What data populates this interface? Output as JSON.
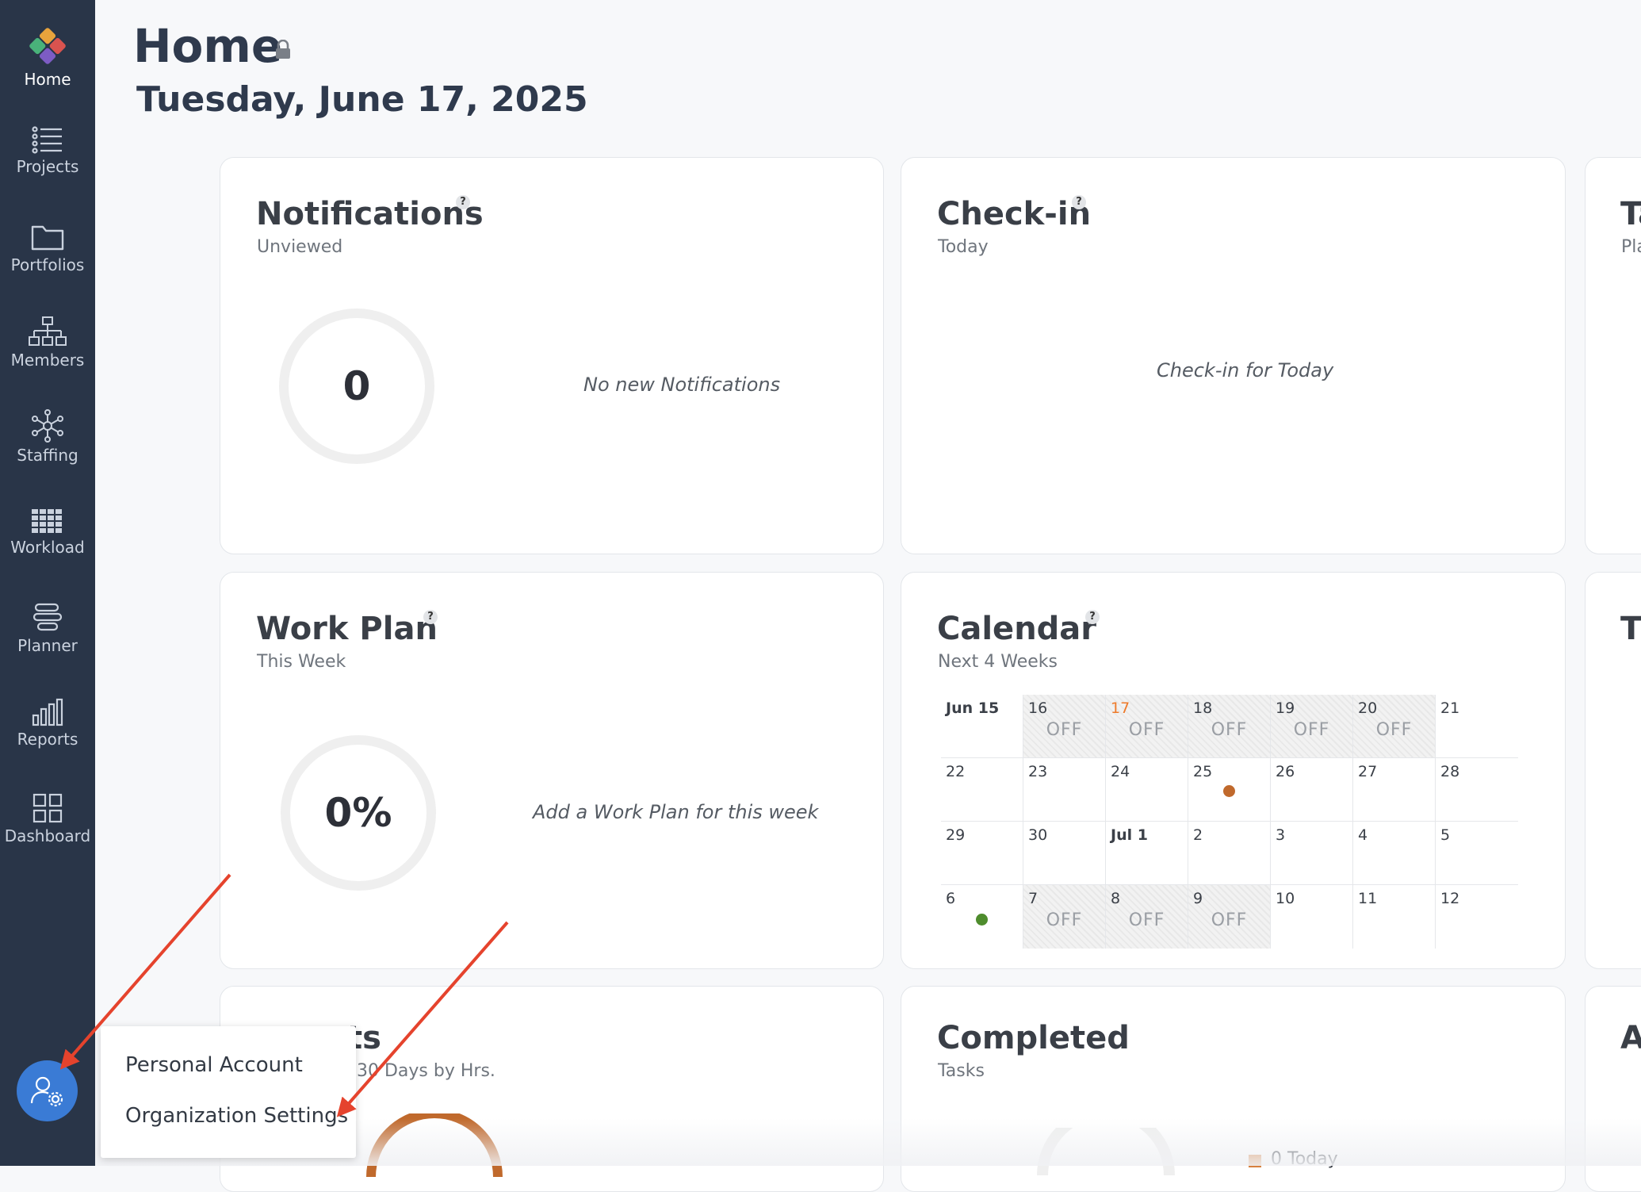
{
  "sidebar": {
    "items": [
      {
        "label": "Home",
        "icon": "logo-icon"
      },
      {
        "label": "Projects",
        "icon": "list-icon"
      },
      {
        "label": "Portfolios",
        "icon": "folder-icon"
      },
      {
        "label": "Members",
        "icon": "org-chart-icon"
      },
      {
        "label": "Staffing",
        "icon": "network-icon"
      },
      {
        "label": "Workload",
        "icon": "grid-icon"
      },
      {
        "label": "Planner",
        "icon": "planner-icon"
      },
      {
        "label": "Reports",
        "icon": "bar-chart-icon"
      },
      {
        "label": "Dashboard",
        "icon": "dashboard-icon"
      }
    ],
    "settings_icon": "user-settings-icon"
  },
  "header": {
    "title": "Home",
    "date": "Tuesday, June 17, 2025"
  },
  "cards": {
    "notifications": {
      "title": "Notifications",
      "subtitle": "Unviewed",
      "count": "0",
      "message": "No new Notifications"
    },
    "checkin": {
      "title": "Check-in",
      "subtitle": "Today",
      "message": "Check-in for Today"
    },
    "third_top": {
      "title": "Ta",
      "subtitle": "Pla"
    },
    "workplan": {
      "title": "Work Plan",
      "subtitle": "This Week",
      "percent": "0%",
      "message": "Add a Work Plan for this week"
    },
    "calendar": {
      "title": "Calendar",
      "subtitle": "Next 4 Weeks"
    },
    "third_mid": {
      "title": "T"
    },
    "projects": {
      "title": "ts",
      "subtitle": "30 Days by Hrs."
    },
    "completed": {
      "title": "Completed",
      "subtitle": "Tasks",
      "legend": "0 Today"
    },
    "third_bottom": {
      "title": "A"
    }
  },
  "calendar": {
    "off_label": "OFF",
    "weeks": [
      [
        {
          "d": "Jun 15",
          "strong": true
        },
        {
          "d": "16",
          "off": true
        },
        {
          "d": "17",
          "off": true,
          "today": true
        },
        {
          "d": "18",
          "off": true
        },
        {
          "d": "19",
          "off": true
        },
        {
          "d": "20",
          "off": true
        },
        {
          "d": "21"
        }
      ],
      [
        {
          "d": "22"
        },
        {
          "d": "23"
        },
        {
          "d": "24"
        },
        {
          "d": "25",
          "dot": "#c0692c"
        },
        {
          "d": "26"
        },
        {
          "d": "27"
        },
        {
          "d": "28"
        }
      ],
      [
        {
          "d": "29"
        },
        {
          "d": "30"
        },
        {
          "d": "Jul 1",
          "strong": true
        },
        {
          "d": "2"
        },
        {
          "d": "3"
        },
        {
          "d": "4"
        },
        {
          "d": "5"
        }
      ],
      [
        {
          "d": "6",
          "dot": "#4e8c2d"
        },
        {
          "d": "7",
          "off": true
        },
        {
          "d": "8",
          "off": true
        },
        {
          "d": "9",
          "off": true
        },
        {
          "d": "10"
        },
        {
          "d": "11"
        },
        {
          "d": "12"
        }
      ]
    ]
  },
  "menu": {
    "items": [
      "Personal Account",
      "Organization Settings"
    ]
  },
  "colors": {
    "sidebar_bg": "#293548",
    "accent": "#3a7bd5",
    "today": "#ee7a2a",
    "annotation_arrow": "#e5432d"
  }
}
